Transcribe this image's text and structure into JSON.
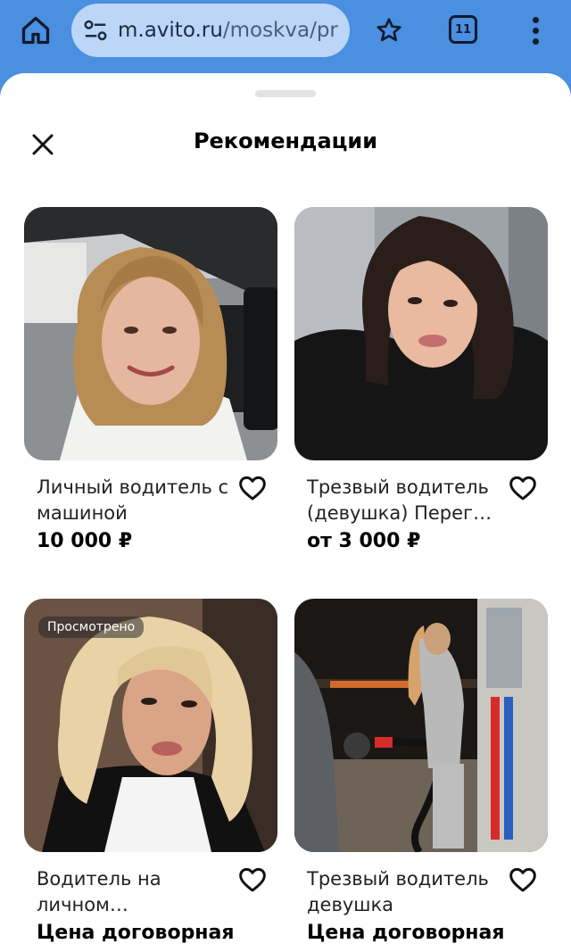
{
  "browser": {
    "url_host": "m.avito.ru",
    "url_path": "/moskva/pr",
    "tab_count": "11"
  },
  "sheet": {
    "title": "Рекомендации"
  },
  "listings": [
    {
      "title": "Личный водитель с машиной",
      "price": "10 000 ₽",
      "badge": ""
    },
    {
      "title": "Трезвый водитель (девушка) Перег…",
      "price": "от 3 000 ₽",
      "badge": ""
    },
    {
      "title": "Водитель на личном…",
      "price": "Цена договорная",
      "badge": "Просмотрено"
    },
    {
      "title": "Трезвый водитель девушка",
      "price": "Цена договорная",
      "badge": ""
    }
  ],
  "colors": {
    "browser_bar": "#4a8fe0",
    "url_pill": "#bcd6f7",
    "text_primary": "#222222"
  }
}
